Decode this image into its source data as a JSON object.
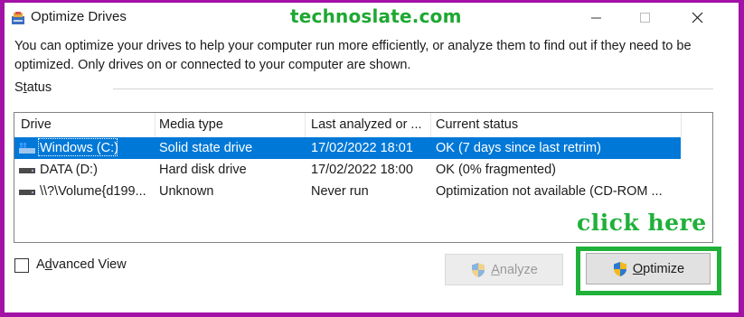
{
  "window": {
    "title": "Optimize Drives",
    "watermark": "technoslate.com"
  },
  "description": "You can optimize your drives to help your computer run more efficiently, or analyze them to find out if they need to be optimized. Only drives on or connected to your computer are shown.",
  "status": {
    "label_pre": "S",
    "label_ul": "t",
    "label_post": "atus"
  },
  "table": {
    "headers": [
      "Drive",
      "Media type",
      "Last analyzed or ...",
      "Current status"
    ],
    "rows": [
      {
        "drive": "Windows (C:)",
        "media": "Solid state drive",
        "last": "17/02/2022 18:01",
        "status": "OK (7 days since last retrim)",
        "icon": "windows-drive-icon",
        "selected": true
      },
      {
        "drive": "DATA (D:)",
        "media": "Hard disk drive",
        "last": "17/02/2022 18:00",
        "status": "OK (0% fragmented)",
        "icon": "hard-drive-icon",
        "selected": false
      },
      {
        "drive": "\\\\?\\Volume{d199...",
        "media": "Unknown",
        "last": "Never run",
        "status": "Optimization not available (CD-ROM ...",
        "icon": "hard-drive-icon",
        "selected": false
      }
    ]
  },
  "advanced_view": {
    "label_pre": "A",
    "label_ul": "d",
    "label_post": "vanced View",
    "checked": false
  },
  "buttons": {
    "analyze_ul": "A",
    "analyze_post": "nalyze",
    "optimize_ul": "O",
    "optimize_post": "ptimize"
  },
  "annotation": {
    "text": "click here",
    "color": "#1fb139"
  },
  "colors": {
    "frame": "#a312a6",
    "selection": "#0078d7"
  }
}
